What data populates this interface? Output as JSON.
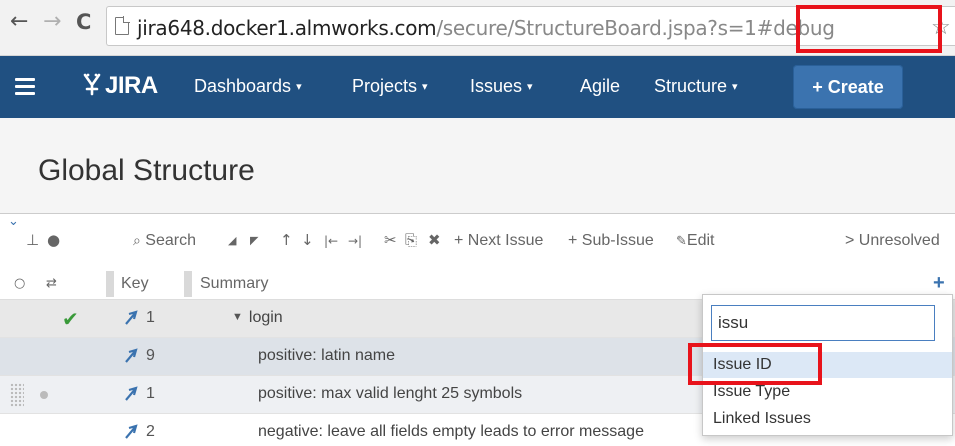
{
  "browser": {
    "back_glyph": "←",
    "forward_glyph": "→",
    "reload_glyph": "C",
    "url_host": "jira648.docker1.almworks.com",
    "url_path": "/secure/StructureBoard.jspa?s=1#debug",
    "bookmark_glyph": "☆"
  },
  "header": {
    "logo_text": "JIRA",
    "nav": [
      {
        "label": "Dashboards",
        "has_caret": true
      },
      {
        "label": "Projects",
        "has_caret": true
      },
      {
        "label": "Issues",
        "has_caret": true
      },
      {
        "label": "Agile",
        "has_caret": false
      },
      {
        "label": "Structure",
        "has_caret": true
      }
    ],
    "caret": "▾",
    "create_label": "+ Create",
    "brand_color": "#205081"
  },
  "page": {
    "title": "Global Structure"
  },
  "toolbar": {
    "search_label": "Search",
    "next_issue_label": "+ Next Issue",
    "sub_issue_label": "+ Sub-Issue",
    "edit_label": "Edit",
    "unresolved_label": "> Unresolved"
  },
  "columns": {
    "key": "Key",
    "summary": "Summary"
  },
  "rows": [
    {
      "key": "1",
      "summary": "login",
      "expanded": true,
      "resolved": true
    },
    {
      "key": "9",
      "summary": "positive: latin name"
    },
    {
      "key": "1",
      "summary": "positive: max valid lenght 25 symbols"
    },
    {
      "key": "2",
      "summary": "negative: leave all fields empty leads to error message"
    }
  ],
  "column_picker": {
    "search_value": "issu",
    "options": [
      {
        "label": "Issue ID",
        "active": true
      },
      {
        "label": "Issue Type",
        "active": false
      },
      {
        "label": "Linked Issues",
        "active": false
      }
    ]
  },
  "highlight_color": "#e8131b"
}
